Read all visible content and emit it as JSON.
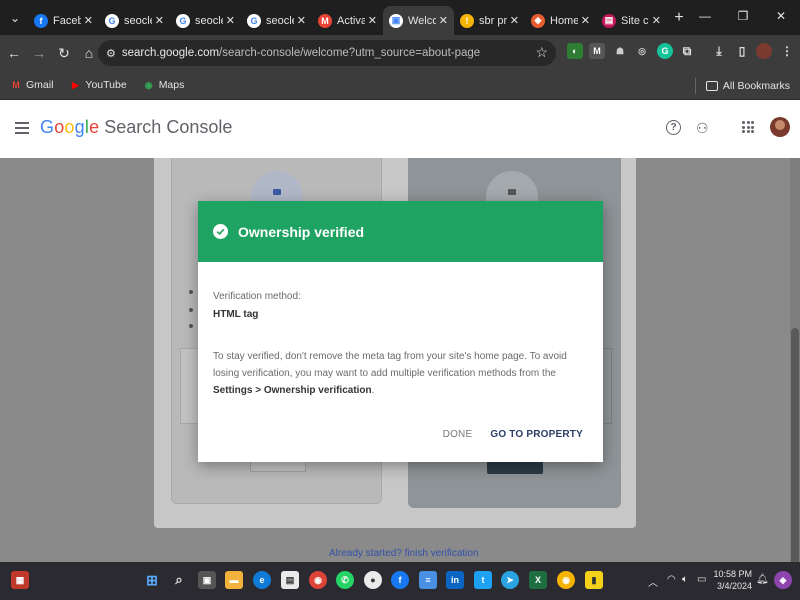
{
  "browser": {
    "tabs": [
      {
        "title": "Facebook",
        "favicon": "facebook-icon",
        "color": "#1877f2",
        "glyph": "f",
        "active": false
      },
      {
        "title": "seoclerk",
        "favicon": "google-icon",
        "color": "#ffffff",
        "glyph": "G",
        "active": false
      },
      {
        "title": "seoclerk",
        "favicon": "google-icon",
        "color": "#ffffff",
        "glyph": "G",
        "active": false
      },
      {
        "title": "seoclerk",
        "favicon": "google-icon",
        "color": "#ffffff",
        "glyph": "G",
        "active": false
      },
      {
        "title": "Activate",
        "favicon": "gmail-icon",
        "color": "#ea4335",
        "glyph": "M",
        "active": false
      },
      {
        "title": "Welcome",
        "favicon": "search-console-icon",
        "color": "#ffffff",
        "glyph": "▣",
        "active": true
      },
      {
        "title": "sbr pro",
        "favicon": "pin-icon",
        "color": "#f4b400",
        "glyph": "!",
        "active": false
      },
      {
        "title": "Home",
        "favicon": "home-icon",
        "color": "#e85d2f",
        "glyph": "◆",
        "active": false
      },
      {
        "title": "Site con",
        "favicon": "site-icon",
        "color": "#c2185b",
        "glyph": "▤",
        "active": false
      }
    ],
    "url_host": "search.google.com",
    "url_path": "/search-console/welcome?utm_source=about-page",
    "bookmarks": [
      {
        "label": "Gmail",
        "icon": "gmail-icon",
        "color": "#ea4335",
        "glyph": "M"
      },
      {
        "label": "YouTube",
        "icon": "youtube-icon",
        "color": "#ff0000",
        "glyph": "▶"
      },
      {
        "label": "Maps",
        "icon": "maps-icon",
        "color": "#34a853",
        "glyph": "◉"
      }
    ],
    "all_bookmarks": "All Bookmarks"
  },
  "app": {
    "brand": "Google",
    "product": "Search Console",
    "below_link": "Already started? finish verification"
  },
  "dialog": {
    "title": "Ownership verified",
    "method_label": "Verification method:",
    "method_value": "HTML tag",
    "message": "To stay verified, don't remove the meta tag from your site's home page. To avoid losing verification, you may want to add multiple verification methods from the",
    "settings_path": "Settings > Ownership verification",
    "message_end": ".",
    "done_label": "DONE",
    "go_label": "GO TO PROPERTY",
    "accent_color": "#1ea362"
  },
  "taskbar": {
    "time": "10:58 PM",
    "date": "3/4/2024"
  }
}
